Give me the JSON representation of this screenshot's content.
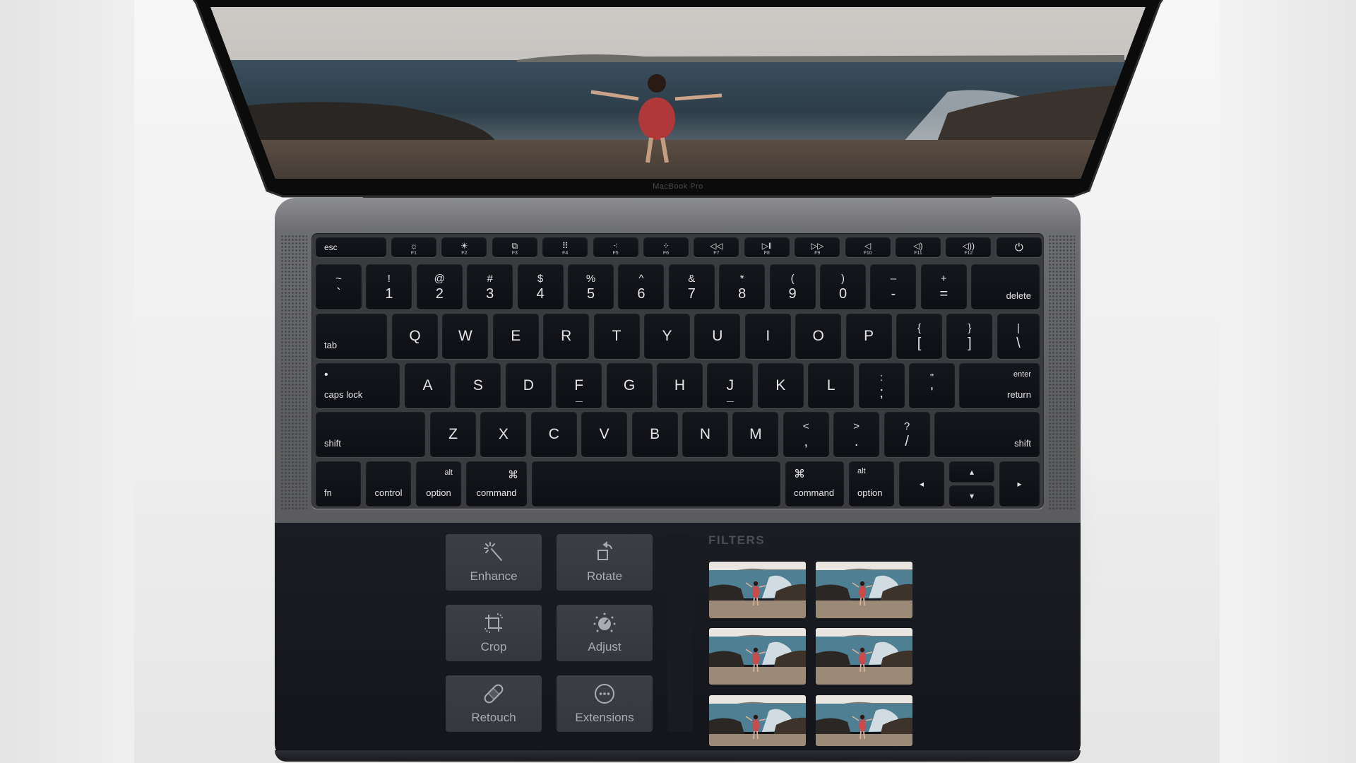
{
  "device": {
    "brand_label": "MacBook Pro",
    "screen_content": "beach-photo-woman-in-red-dress-waves"
  },
  "keyboard": {
    "function_row": [
      {
        "label": "esc"
      },
      {
        "icon": "brightness-down-icon",
        "glyph": "☼",
        "fn": "F1"
      },
      {
        "icon": "brightness-up-icon",
        "glyph": "☀",
        "fn": "F2"
      },
      {
        "icon": "mission-control-icon",
        "glyph": "⧉",
        "fn": "F3"
      },
      {
        "icon": "launchpad-icon",
        "glyph": "⠿",
        "fn": "F4"
      },
      {
        "icon": "keyboard-light-down-icon",
        "glyph": "⁖",
        "fn": "F5"
      },
      {
        "icon": "keyboard-light-up-icon",
        "glyph": "⁘",
        "fn": "F6"
      },
      {
        "icon": "rewind-icon",
        "glyph": "◁◁",
        "fn": "F7"
      },
      {
        "icon": "play-pause-icon",
        "glyph": "▷‖",
        "fn": "F8"
      },
      {
        "icon": "fast-forward-icon",
        "glyph": "▷▷",
        "fn": "F9"
      },
      {
        "icon": "mute-icon",
        "glyph": "◁",
        "fn": "F10"
      },
      {
        "icon": "volume-down-icon",
        "glyph": "◁)",
        "fn": "F11"
      },
      {
        "icon": "volume-up-icon",
        "glyph": "◁))",
        "fn": "F12"
      },
      {
        "icon": "power-icon",
        "glyph": "⏻"
      }
    ],
    "number_row": [
      {
        "top": "~",
        "bottom": "`"
      },
      {
        "top": "!",
        "bottom": "1"
      },
      {
        "top": "@",
        "bottom": "2"
      },
      {
        "top": "#",
        "bottom": "3"
      },
      {
        "top": "$",
        "bottom": "4"
      },
      {
        "top": "%",
        "bottom": "5"
      },
      {
        "top": "^",
        "bottom": "6"
      },
      {
        "top": "&",
        "bottom": "7"
      },
      {
        "top": "*",
        "bottom": "8"
      },
      {
        "top": "(",
        "bottom": "9"
      },
      {
        "top": ")",
        "bottom": "0"
      },
      {
        "top": "–",
        "bottom": "-"
      },
      {
        "top": "+",
        "bottom": "="
      },
      {
        "label": "delete"
      }
    ],
    "qwerty_row": [
      {
        "label": "tab"
      },
      {
        "main": "Q"
      },
      {
        "main": "W"
      },
      {
        "main": "E"
      },
      {
        "main": "R"
      },
      {
        "main": "T"
      },
      {
        "main": "Y"
      },
      {
        "main": "U"
      },
      {
        "main": "I"
      },
      {
        "main": "O"
      },
      {
        "main": "P"
      },
      {
        "top": "{",
        "bottom": "["
      },
      {
        "top": "}",
        "bottom": "]"
      },
      {
        "top": "|",
        "bottom": "\\"
      }
    ],
    "home_row": [
      {
        "label": "caps lock",
        "indicator": "•"
      },
      {
        "main": "A"
      },
      {
        "main": "S"
      },
      {
        "main": "D"
      },
      {
        "main": "F"
      },
      {
        "main": "G"
      },
      {
        "main": "H"
      },
      {
        "main": "J"
      },
      {
        "main": "K"
      },
      {
        "main": "L"
      },
      {
        "top": ":",
        "bottom": ";"
      },
      {
        "top": "\"",
        "bottom": "'"
      },
      {
        "label": "return",
        "sub": "enter"
      }
    ],
    "shift_row": [
      {
        "label": "shift"
      },
      {
        "main": "Z"
      },
      {
        "main": "X"
      },
      {
        "main": "C"
      },
      {
        "main": "V"
      },
      {
        "main": "B"
      },
      {
        "main": "N"
      },
      {
        "main": "M"
      },
      {
        "top": "<",
        "bottom": ","
      },
      {
        "top": ">",
        "bottom": "."
      },
      {
        "top": "?",
        "bottom": "/"
      },
      {
        "label": "shift"
      }
    ],
    "bottom_row": {
      "fn": "fn",
      "control": "control",
      "option_left": {
        "label": "option",
        "sub": "alt"
      },
      "command_left": {
        "label": "command",
        "symbol": "⌘"
      },
      "space": "",
      "command_right": {
        "label": "command",
        "symbol": "⌘"
      },
      "option_right": {
        "label": "option",
        "sub": "alt"
      },
      "arrow_left": "◂",
      "arrow_up": "▴",
      "arrow_down": "▾",
      "arrow_right": "▸"
    }
  },
  "touch_bar": {
    "tools": [
      {
        "label": "Enhance",
        "icon": "magic-wand-icon"
      },
      {
        "label": "Rotate",
        "icon": "rotate-icon"
      },
      {
        "label": "Crop",
        "icon": "crop-icon"
      },
      {
        "label": "Adjust",
        "icon": "adjust-dial-icon"
      },
      {
        "label": "Retouch",
        "icon": "bandage-icon"
      },
      {
        "label": "Extensions",
        "icon": "more-icon"
      }
    ],
    "filters_label": "FILTERS",
    "filter_thumbnails": 6
  },
  "colors": {
    "key_face": "#0f1116",
    "key_text": "#e4e4e6",
    "chassis": "#5d5e61",
    "touchbar_bg": "#16181e",
    "tile_bg": "#3a3c42",
    "tile_text": "#a9abb0",
    "filters_label": "#4b4e56"
  }
}
